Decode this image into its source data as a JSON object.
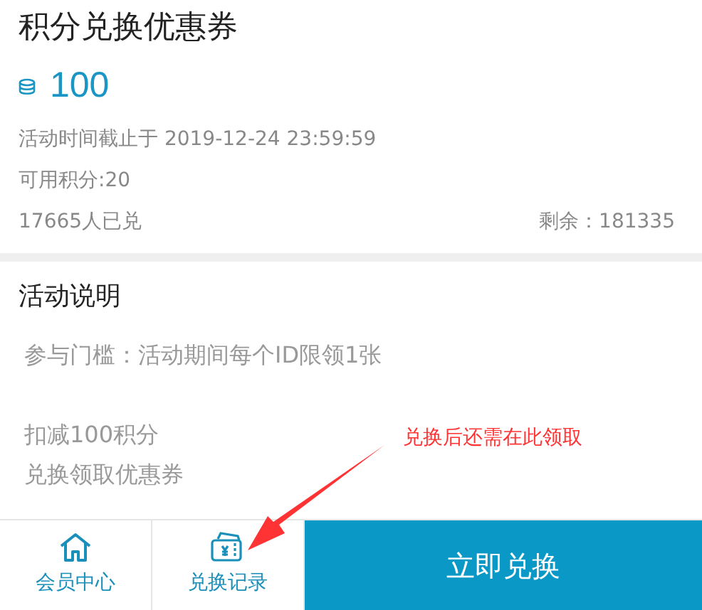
{
  "title": "积分兑换优惠券",
  "points": "100",
  "info": {
    "deadline": "活动时间截止于 2019-12-24 23:59:59",
    "available": "可用积分:20",
    "redeemed": "17665人已兑",
    "remaining": "剩余：181335"
  },
  "description": {
    "heading": "活动说明",
    "lines": [
      "参与门槛：活动期间每个ID限领1张",
      "扣减100积分",
      "兑换领取优惠券"
    ]
  },
  "annotation": "兑换后还需在此领取",
  "bottom_bar": {
    "tabs": [
      {
        "kind": "home",
        "label": "会员中心"
      },
      {
        "kind": "wallet",
        "label": "兑换记录"
      }
    ],
    "action": "立即兑换"
  }
}
